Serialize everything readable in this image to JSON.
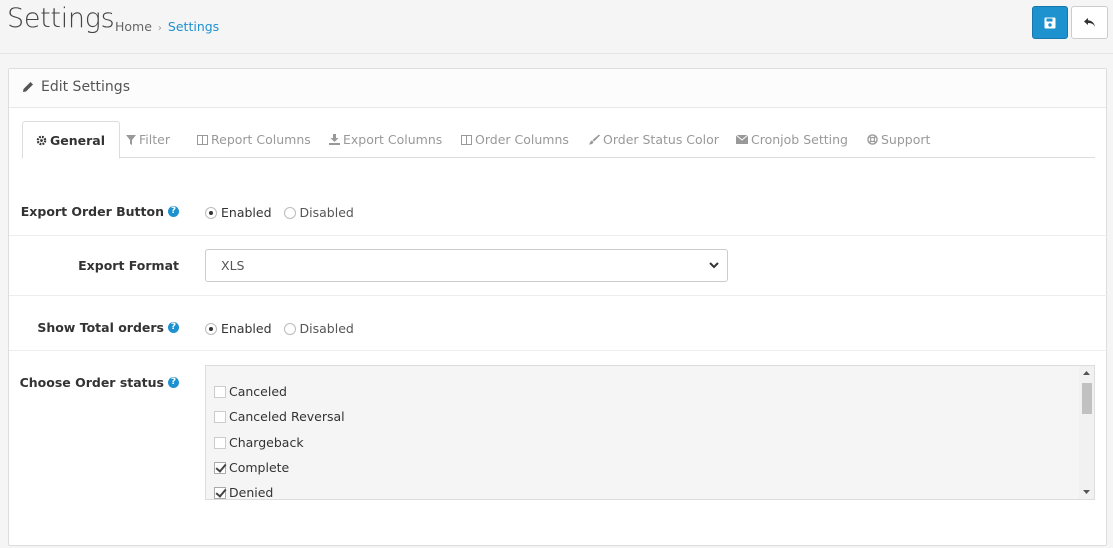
{
  "header": {
    "title": "Settings",
    "breadcrumb": {
      "home": "Home",
      "separator": "›",
      "current": "Settings"
    }
  },
  "toolbar": {
    "save_icon": "floppy-disk-icon",
    "back_icon": "reply-icon"
  },
  "panel": {
    "title": "Edit Settings",
    "tabs": [
      {
        "label": "General",
        "icon": "gear-icon",
        "active": true
      },
      {
        "label": "Filter",
        "icon": "filter-icon"
      },
      {
        "label": "Report Columns",
        "icon": "columns-icon"
      },
      {
        "label": "Export Columns",
        "icon": "download-icon"
      },
      {
        "label": "Order Columns",
        "icon": "columns-icon"
      },
      {
        "label": "Order Status Color",
        "icon": "paint-brush-icon"
      },
      {
        "label": "Cronjob Setting",
        "icon": "envelope-icon"
      },
      {
        "label": "Support",
        "icon": "life-ring-icon"
      }
    ]
  },
  "form": {
    "export_order_button": {
      "label": "Export Order Button",
      "options": [
        "Enabled",
        "Disabled"
      ],
      "selected": "Enabled"
    },
    "export_format": {
      "label": "Export Format",
      "value": "XLS"
    },
    "show_total_orders": {
      "label": "Show Total orders",
      "options": [
        "Enabled",
        "Disabled"
      ],
      "selected": "Enabled"
    },
    "choose_order_status": {
      "label": "Choose Order status",
      "items": [
        {
          "label": "Canceled",
          "checked": false
        },
        {
          "label": "Canceled Reversal",
          "checked": false
        },
        {
          "label": "Chargeback",
          "checked": false
        },
        {
          "label": "Complete",
          "checked": true
        },
        {
          "label": "Denied",
          "checked": true
        }
      ]
    }
  },
  "colors": {
    "accent": "#1e91cf",
    "background": "#f5f5f5"
  }
}
